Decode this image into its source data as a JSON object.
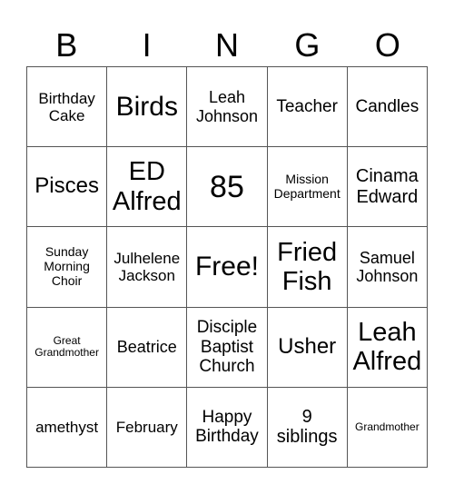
{
  "header": [
    "B",
    "I",
    "N",
    "G",
    "O"
  ],
  "cells": [
    [
      "Birthday Cake",
      "Birds",
      "Leah Johnson",
      "Teacher",
      "Candles"
    ],
    [
      "Pisces",
      "ED Alfred",
      "85",
      "Mission Department",
      "Cinama Edward"
    ],
    [
      "Sunday Morning Choir",
      "Julhelene Jackson",
      "Free!",
      "Fried Fish",
      "Samuel Johnson"
    ],
    [
      "Great Grandmother",
      "Beatrice",
      "Disciple Baptist Church",
      "Usher",
      "Leah Alfred"
    ],
    [
      "amethyst",
      "February",
      "Happy Birthday",
      "9 siblings",
      "Grandmother"
    ]
  ]
}
